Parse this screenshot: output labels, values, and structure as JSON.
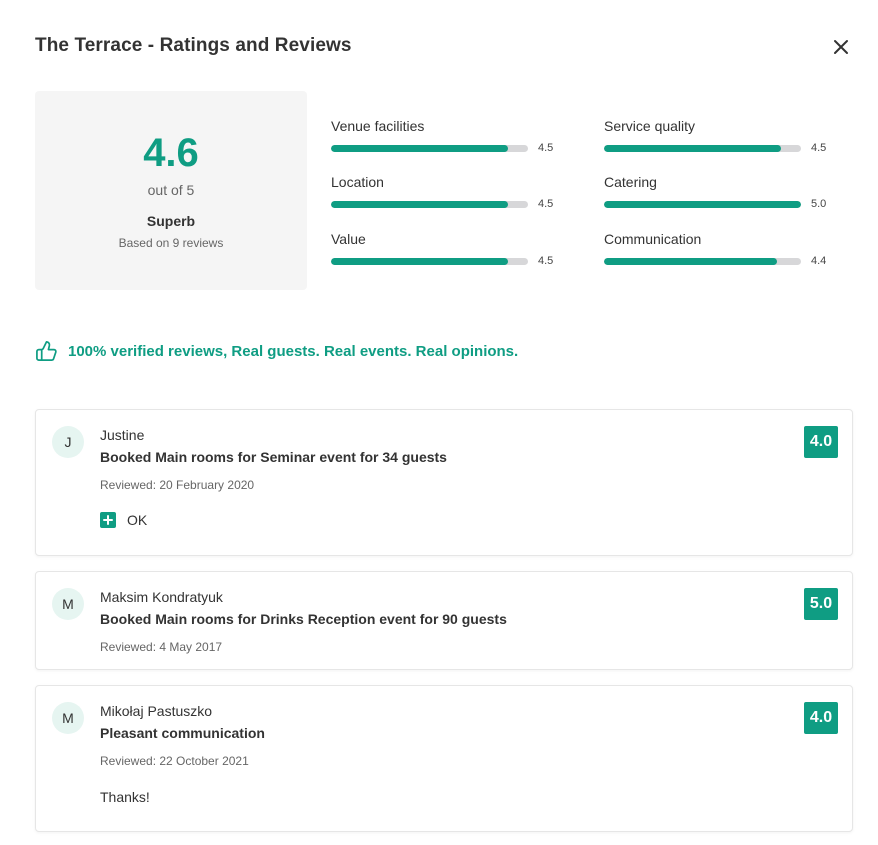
{
  "header": {
    "title": "The Terrace - Ratings and Reviews"
  },
  "overall": {
    "score": "4.6",
    "out_of": "out of 5",
    "label": "Superb",
    "based_on": "Based on 9 reviews"
  },
  "ratings": [
    {
      "name": "Venue facilities",
      "value": "4.5",
      "fraction": 0.9
    },
    {
      "name": "Service quality",
      "value": "4.5",
      "fraction": 0.9
    },
    {
      "name": "Location",
      "value": "4.5",
      "fraction": 0.9
    },
    {
      "name": "Catering",
      "value": "5.0",
      "fraction": 1.0
    },
    {
      "name": "Value",
      "value": "4.5",
      "fraction": 0.9
    },
    {
      "name": "Communication",
      "value": "4.4",
      "fraction": 0.88
    }
  ],
  "verified_text": "100% verified reviews, Real guests. Real events. Real opinions.",
  "reviews": [
    {
      "initial": "J",
      "name": "Justine",
      "booked": "Booked Main rooms for Seminar event for 34 guests",
      "reviewed": "Reviewed: 20 February 2020",
      "score": "4.0",
      "pro": "OK"
    },
    {
      "initial": "M",
      "name": "Maksim Kondratyuk",
      "booked": "Booked Main rooms for Drinks Reception event for 90 guests",
      "reviewed": "Reviewed: 4 May 2017",
      "score": "5.0"
    },
    {
      "initial": "M",
      "name": "Mikołaj Pastuszko",
      "booked": "Pleasant communication",
      "reviewed": "Reviewed: 22 October 2021",
      "score": "4.0",
      "comment": "Thanks!"
    }
  ],
  "colors": {
    "accent": "#0f9d83",
    "bar_track": "#d7d7d9",
    "panel_bg": "#f5f5f5",
    "avatar_bg": "#e6f5f1"
  },
  "icons": {
    "close": "close-icon",
    "verified": "thumbs-up-icon",
    "pro": "plus-icon"
  }
}
